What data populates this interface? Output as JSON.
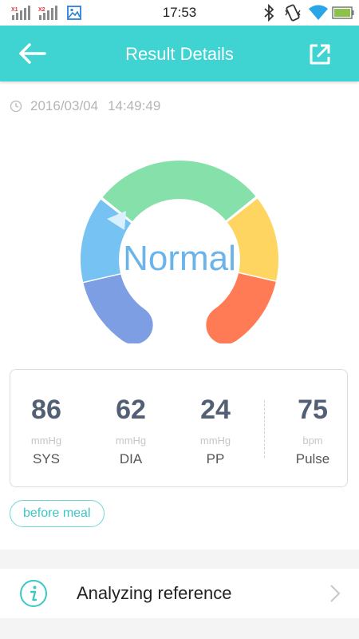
{
  "status_bar": {
    "time": "17:53",
    "sim1_label": "X1",
    "sim2_label": "X2",
    "icons": [
      "signal-sim1-icon",
      "signal-sim2-icon",
      "image-notification-icon",
      "bluetooth-icon",
      "vibrate-icon",
      "wifi-icon",
      "battery-icon"
    ]
  },
  "app_bar": {
    "title": "Result Details",
    "back_icon": "arrow-left-icon",
    "share_icon": "share-external-icon",
    "color": "#3fd3d2"
  },
  "record": {
    "date": "2016/03/04",
    "time": "14:49:49",
    "clock_icon": "clock-icon"
  },
  "gauge": {
    "status_label": "Normal",
    "needle_level": 0.3,
    "segments": [
      {
        "name": "low",
        "color": "#7d9ee3"
      },
      {
        "name": "optimal",
        "color": "#76c3f3"
      },
      {
        "name": "normal",
        "color": "#86e0a9"
      },
      {
        "name": "elevated",
        "color": "#ffd562"
      },
      {
        "name": "high",
        "color": "#ff7b56"
      }
    ]
  },
  "readings": [
    {
      "value": "86",
      "unit": "mmHg",
      "label": "SYS"
    },
    {
      "value": "62",
      "unit": "mmHg",
      "label": "DIA"
    },
    {
      "value": "24",
      "unit": "mmHg",
      "label": "PP"
    },
    {
      "value": "75",
      "unit": "bpm",
      "label": "Pulse"
    }
  ],
  "meal_tag": "before meal",
  "reference": {
    "label": "Analyzing reference",
    "icon": "info-icon",
    "chevron": "chevron-right-icon"
  }
}
